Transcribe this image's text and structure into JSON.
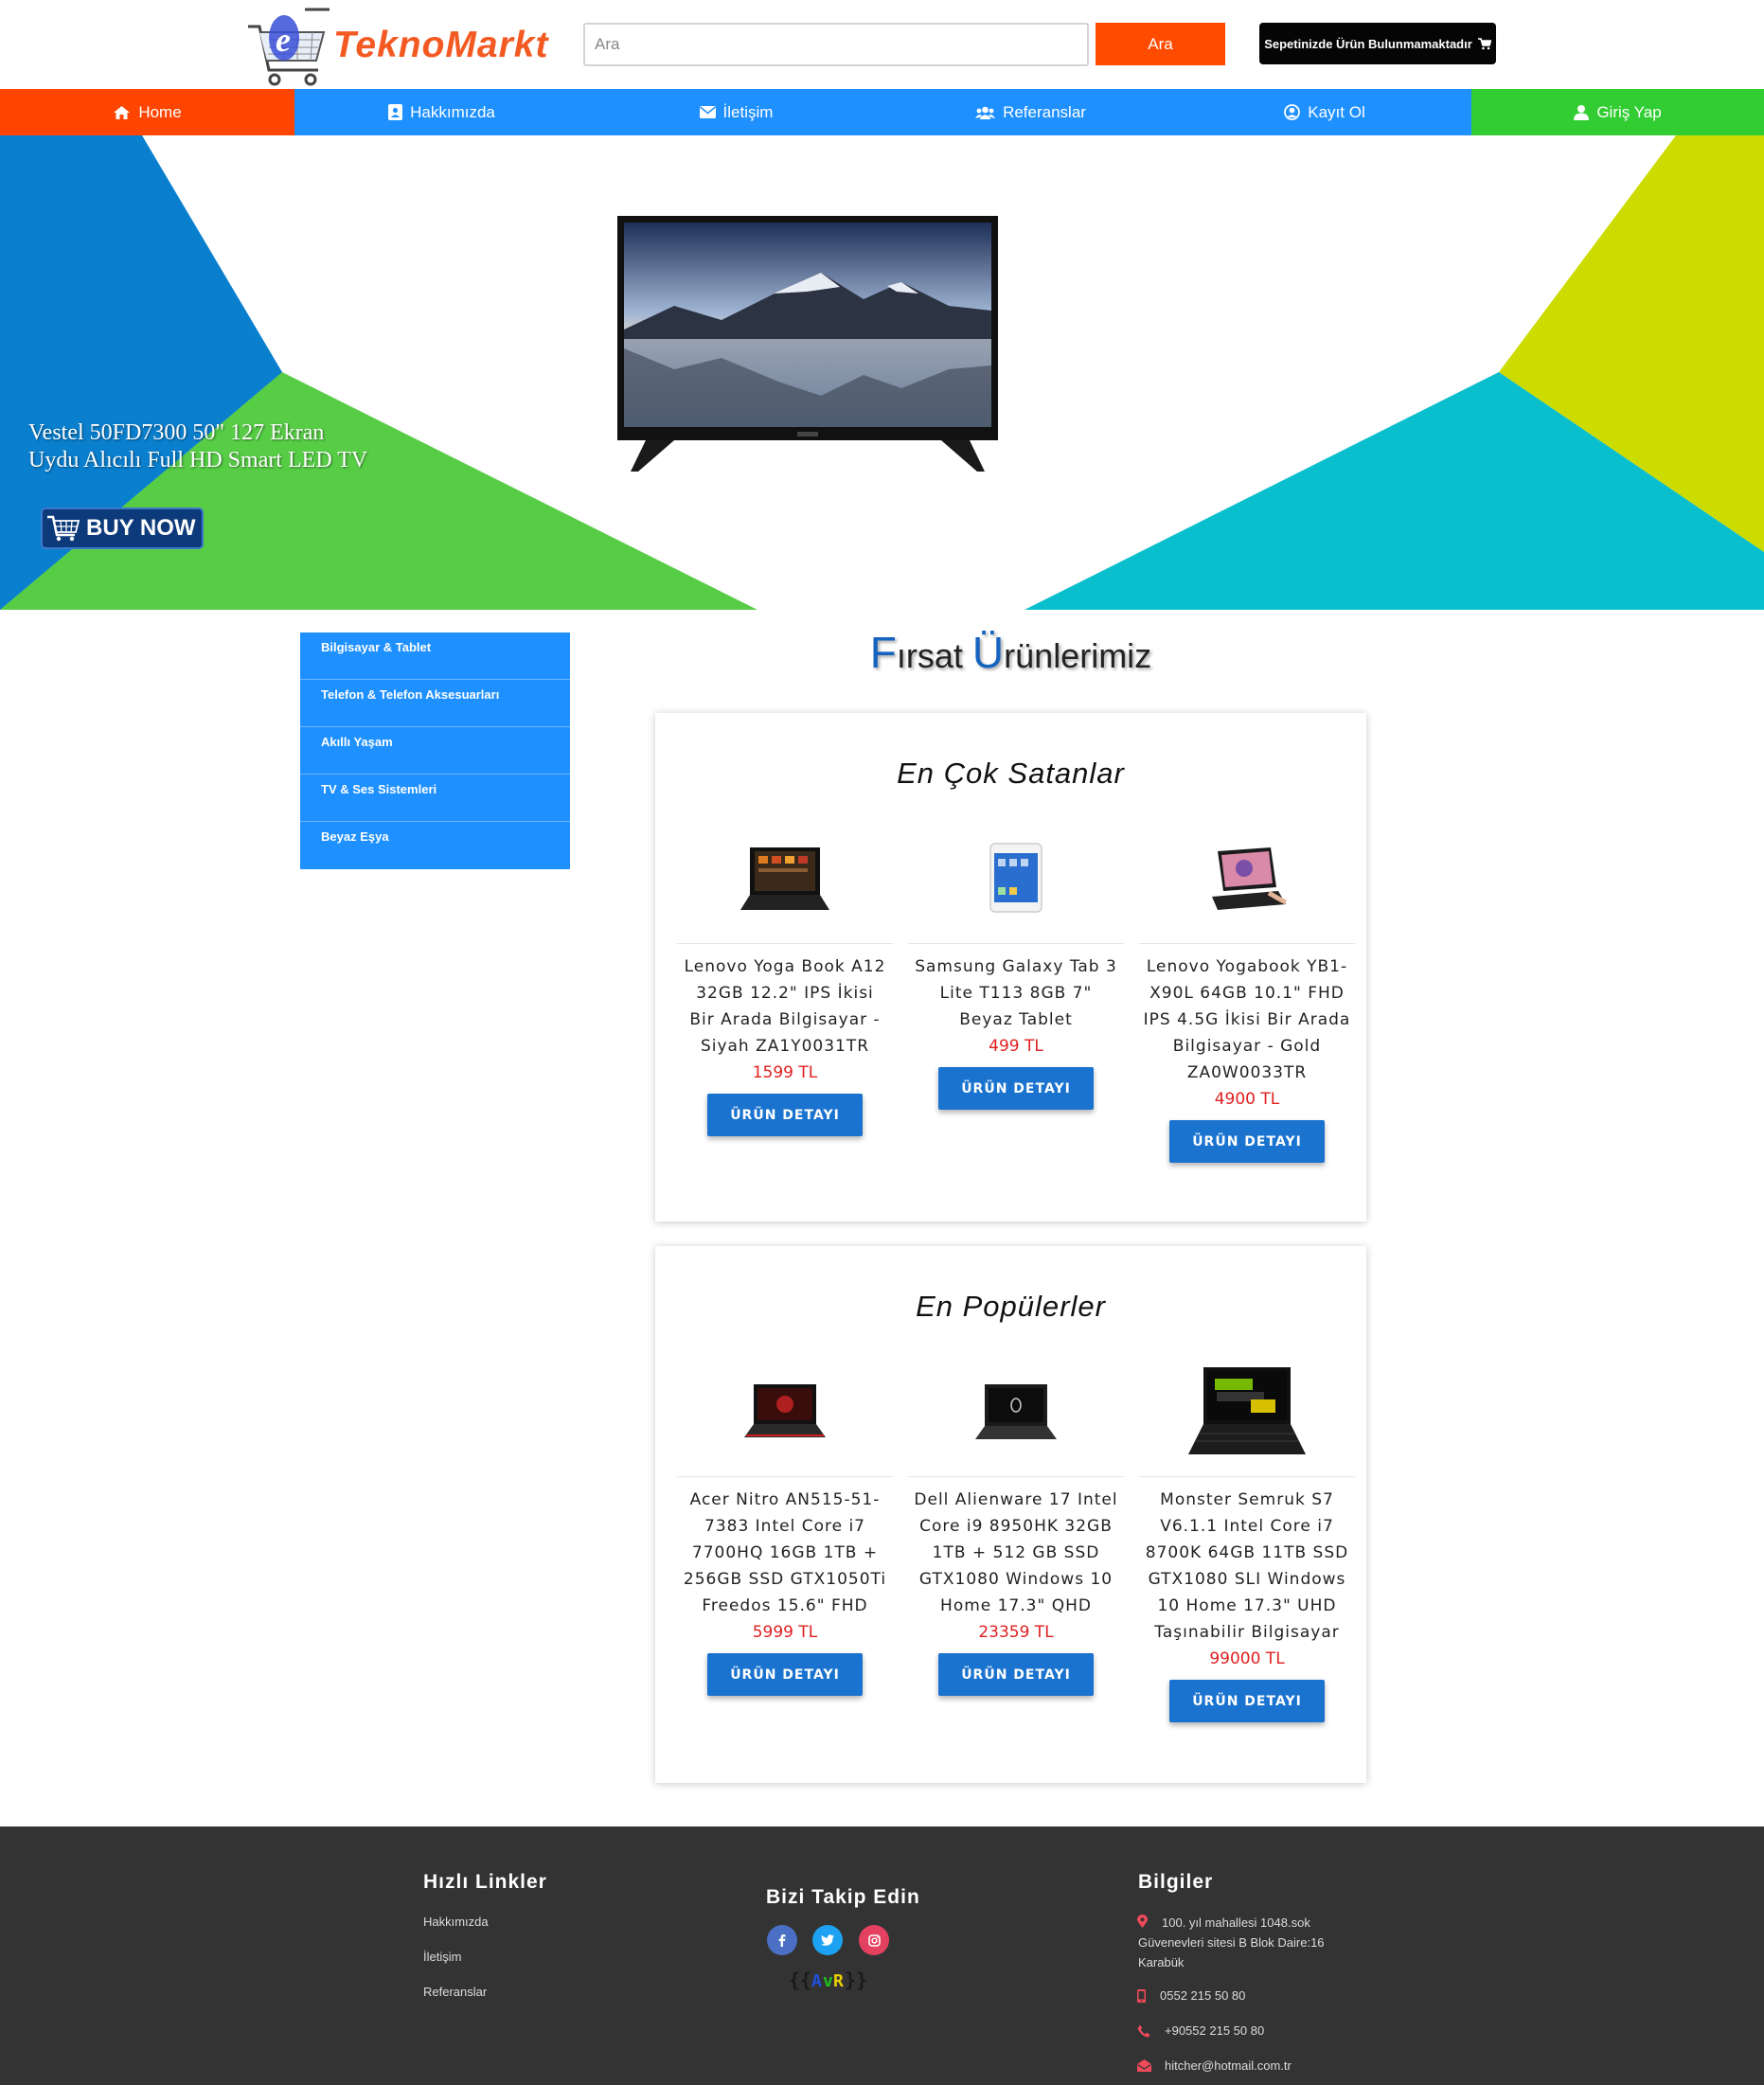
{
  "header": {
    "logo_text": "TeknoMarkt",
    "search_placeholder": "Ara",
    "search_button": "Ara",
    "cart_label": "Sepetinizde Ürün Bulunmamaktadır"
  },
  "nav": [
    {
      "label": "Home",
      "icon": "home-icon",
      "color": "#ff4500"
    },
    {
      "label": "Hakkımızda",
      "icon": "contact-card-icon",
      "color": "#1e90ff"
    },
    {
      "label": "İletişim",
      "icon": "envelope-icon",
      "color": "#1e90ff"
    },
    {
      "label": "Referanslar",
      "icon": "users-icon",
      "color": "#1e90ff"
    },
    {
      "label": "Kayıt Ol",
      "icon": "user-circle-icon",
      "color": "#1e90ff"
    },
    {
      "label": "Giriş Yap",
      "icon": "user-icon",
      "color": "#32cd32"
    }
  ],
  "hero": {
    "caption_line1": "Vestel 50FD7300 50\" 127 Ekran",
    "caption_line2": "Uydu Alıcılı Full HD Smart LED TV",
    "buy_button": "BUY NOW"
  },
  "sidebar": {
    "items": [
      {
        "label": "Bilgisayar & Tablet"
      },
      {
        "label": "Telefon & Telefon Aksesuarları"
      },
      {
        "label": "Akıllı Yaşam"
      },
      {
        "label": "TV & Ses Sistemleri"
      },
      {
        "label": "Beyaz Eşya"
      }
    ]
  },
  "main": {
    "title_cap1": "F",
    "title_rest1": "ırsat ",
    "title_cap2": "Ü",
    "title_rest2": "rünlerimiz",
    "detail_button": "ÜRÜN DETAYI",
    "best_sellers": {
      "title": "En Çok Satanlar",
      "products": [
        {
          "name": "Lenovo Yoga Book A12 32GB 12.2\" IPS İkisi Bir Arada Bilgisayar - Siyah ZA1Y0031TR",
          "price": "1599 TL"
        },
        {
          "name": "Samsung Galaxy Tab 3 Lite T113 8GB 7\" Beyaz Tablet",
          "price": "499 TL"
        },
        {
          "name": "Lenovo Yogabook YB1-X90L 64GB 10.1\" FHD IPS 4.5G İkisi Bir Arada Bilgisayar - Gold ZA0W0033TR",
          "price": "4900 TL"
        }
      ]
    },
    "popular": {
      "title": "En Popülerler",
      "products": [
        {
          "name": "Acer Nitro AN515-51-7383 Intel Core i7 7700HQ 16GB 1TB + 256GB SSD GTX1050Ti Freedos 15.6\" FHD",
          "price": "5999 TL"
        },
        {
          "name": "Dell Alienware 17 Intel Core i9 8950HK 32GB 1TB + 512 GB SSD GTX1080 Windows 10 Home 17.3\" QHD",
          "price": "23359 TL"
        },
        {
          "name": "Monster Semruk S7 V6.1.1 Intel Core i7 8700K 64GB 11TB SSD GTX1080 SLI Windows 10 Home 17.3\" UHD Taşınabilir Bilgisayar",
          "price": "99000 TL"
        }
      ]
    }
  },
  "footer": {
    "quick_links_title": "Hızlı Linkler",
    "quick_links": [
      "Hakkımızda",
      "İletişim",
      "Referanslar"
    ],
    "follow_title": "Bizi Takip Edin",
    "social": [
      {
        "icon": "facebook-icon",
        "color": "#4a6fc4"
      },
      {
        "icon": "twitter-icon",
        "color": "#1da1f2"
      },
      {
        "icon": "instagram-icon",
        "color": "#e4405f"
      }
    ],
    "info_title": "Bilgiler",
    "address_line1": "100. yıl mahallesi 1048.sok",
    "address_line2": "Güvenevleri sitesi B Blok Daire:16",
    "address_line3": "Karabük",
    "phone1": "0552 215 50 80",
    "phone2": "+90552 215 50 80",
    "email": "hitcher@hotmail.com.tr"
  }
}
